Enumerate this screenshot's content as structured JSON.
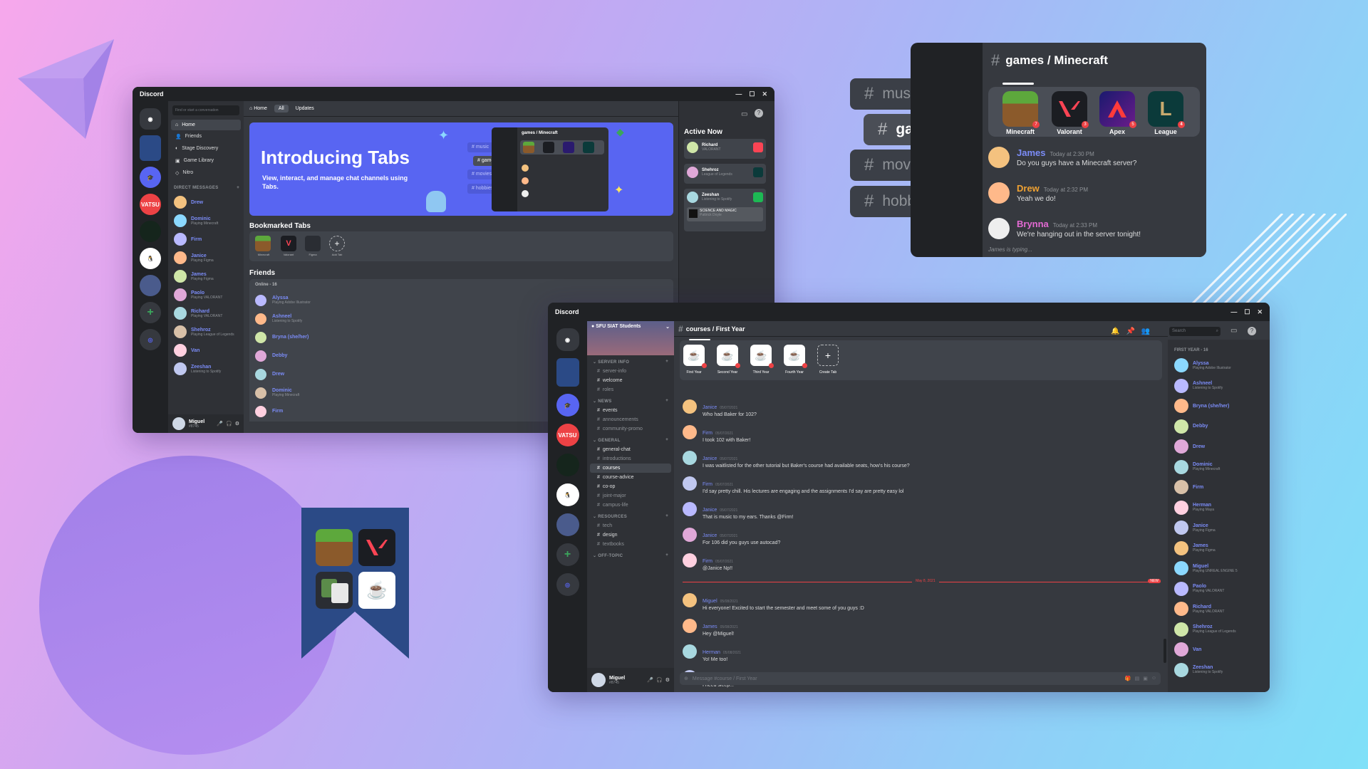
{
  "colors": {
    "blurple": "#5865f2",
    "dark": "#202225",
    "side": "#2f3136",
    "main": "#36393f",
    "red": "#ed4245",
    "green": "#3ba55c",
    "name_blue": "#7b8cf7"
  },
  "pills": [
    "music",
    "games",
    "movies",
    "hobbies"
  ],
  "win_a": {
    "title": "Discord",
    "search_placeholder": "Find or start a conversation",
    "nav": [
      "Home",
      "Friends",
      "Stage Discovery",
      "Game Library",
      "Nitro"
    ],
    "dm_header": "DIRECT MESSAGES",
    "dms": [
      {
        "name": "Drew",
        "status": ""
      },
      {
        "name": "Dominic",
        "status": "Playing Minecraft"
      },
      {
        "name": "Firm",
        "status": ""
      },
      {
        "name": "Janice",
        "status": "Playing Figma"
      },
      {
        "name": "James",
        "status": "Playing Figma"
      },
      {
        "name": "Paolo",
        "status": "Playing VALORANT"
      },
      {
        "name": "Richard",
        "status": "Playing VALORANT"
      },
      {
        "name": "Shehroz",
        "status": "Playing League of Legends"
      },
      {
        "name": "Van",
        "status": ""
      },
      {
        "name": "Zeeshan",
        "status": "Listening to Spotify"
      }
    ],
    "user": {
      "name": "Miguel",
      "tag": "#8745"
    },
    "topbar": {
      "home": "Home",
      "all": "All",
      "updates": "Updates"
    },
    "banner": {
      "title": "Introducing Tabs",
      "subtitle": "View, interact, and manage chat channels using Tabs.",
      "mini_title": "games / Minecraft",
      "mini_tabs": [
        "music",
        "games",
        "movies",
        "hobbies"
      ]
    },
    "bookmarked_title": "Bookmarked Tabs",
    "bookmarked_items": [
      "Minecraft",
      "Valorant",
      "Figma",
      "Add Tab"
    ],
    "friends_title": "Friends",
    "online_label": "Online - 16",
    "friends": [
      {
        "name": "Alyssa",
        "status": "Playing Adobe Illustrator"
      },
      {
        "name": "Ashneel",
        "status": "Listening to Spotify"
      },
      {
        "name": "Bryna (she/her)",
        "status": ""
      },
      {
        "name": "Debby",
        "status": ""
      },
      {
        "name": "Drew",
        "status": ""
      },
      {
        "name": "Dominic",
        "status": "Playing Minecraft"
      },
      {
        "name": "Firm",
        "status": ""
      }
    ],
    "active_now_title": "Active Now",
    "active": [
      {
        "name": "Richard",
        "status": "VALORANT"
      },
      {
        "name": "Shehroz",
        "status": "League of Legends"
      },
      {
        "name": "Zeeshan",
        "status": "Listening to Spotify",
        "extra": "SCIENCE AND MAGIC",
        "extra_sub": "Pattrick Doyle"
      }
    ]
  },
  "tabs_panel": {
    "title": "games / Minecraft",
    "icons": [
      {
        "label": "Minecraft",
        "badge": "7"
      },
      {
        "label": "Valorant",
        "badge": "3"
      },
      {
        "label": "Apex",
        "badge": "5"
      },
      {
        "label": "League",
        "badge": "4"
      }
    ],
    "messages": [
      {
        "name": "James",
        "time": "Today at 2:30 PM",
        "text": "Do you guys have a Minecraft server?",
        "color": "#7b8cf7"
      },
      {
        "name": "Drew",
        "time": "Today at 2:32 PM",
        "text": "Yeah we do!",
        "color": "#f0a232"
      },
      {
        "name": "Brynna",
        "time": "Today at 2:33 PM",
        "text": "We're hanging out in the server tonight!",
        "color": "#e36ad3"
      }
    ],
    "typing": "James is typing..."
  },
  "win_b": {
    "title": "Discord",
    "server_name": "SFU SIAT Students",
    "channel_title": "courses / First Year",
    "search_placeholder": "Search",
    "categories": [
      {
        "name": "SERVER INFO",
        "channels": [
          {
            "n": "server-info",
            "s": "dim"
          },
          {
            "n": "welcome",
            "s": "bright"
          },
          {
            "n": "roles",
            "s": "dim"
          }
        ]
      },
      {
        "name": "NEWS",
        "channels": [
          {
            "n": "events",
            "s": "bright"
          },
          {
            "n": "announcements",
            "s": "dim"
          },
          {
            "n": "community-promo",
            "s": "dim"
          }
        ]
      },
      {
        "name": "GENERAL",
        "channels": [
          {
            "n": "general-chat",
            "s": "bright"
          },
          {
            "n": "introductions",
            "s": "dim"
          },
          {
            "n": "courses",
            "s": "on"
          },
          {
            "n": "course-advice",
            "s": "bright"
          },
          {
            "n": "co-op",
            "s": "bright"
          },
          {
            "n": "joint-major",
            "s": "dim"
          },
          {
            "n": "campus-life",
            "s": "dim"
          }
        ]
      },
      {
        "name": "RESOURCES",
        "channels": [
          {
            "n": "tech",
            "s": "dim"
          },
          {
            "n": "design",
            "s": "bright"
          },
          {
            "n": "textbooks",
            "s": "dim"
          }
        ]
      },
      {
        "name": "OFF-TOPIC",
        "channels": []
      }
    ],
    "year_tabs": [
      "First Year",
      "Second Year",
      "Third Year",
      "Fourth Year",
      "Create Tab"
    ],
    "messages": [
      {
        "name": "Janice",
        "time": "05/07/2021",
        "text": "Who had Baker for 102?"
      },
      {
        "name": "Firm",
        "time": "05/07/2021",
        "text": "I took 102 with Baker!"
      },
      {
        "name": "Janice",
        "time": "05/07/2021",
        "text": "I was waitlisted for the other tutorial but Baker's course had available seats, how's his course?"
      },
      {
        "name": "Firm",
        "time": "05/07/2021",
        "text": "I'd say pretty chill. His lectures are engaging and the assignments I'd say are pretty easy lol"
      },
      {
        "name": "Janice",
        "time": "05/07/2021",
        "text": "That is music to my ears. Thanks @Firm!"
      },
      {
        "name": "Janice",
        "time": "05/07/2021",
        "text": "For 106 did you guys use autocad?"
      },
      {
        "name": "Firm",
        "time": "05/07/2021",
        "text": "@Janice Np!!"
      }
    ],
    "divider_date": "May 8, 2021",
    "divider_tag": "NEW",
    "messages2": [
      {
        "name": "Miguel",
        "time": "05/08/2021",
        "text": "Hi everyone! Excited to start the semester and meet some of you guys :D"
      },
      {
        "name": "James",
        "time": "05/08/2021",
        "text": "Hey @Miguel!"
      },
      {
        "name": "Herman",
        "time": "05/08/2021",
        "text": "Yo! Me too!"
      },
      {
        "name": "Shehroz",
        "time": "05/08/2021",
        "text": "I need sleep..."
      }
    ],
    "input_placeholder": "Message #course / First Year",
    "member_header": "FIRST YEAR - 16",
    "members": [
      {
        "name": "Alyssa",
        "status": "Playing Adobe Illustrator"
      },
      {
        "name": "Ashneel",
        "status": "Listening to Spotify"
      },
      {
        "name": "Bryna (she/her)",
        "status": ""
      },
      {
        "name": "Debby",
        "status": ""
      },
      {
        "name": "Drew",
        "status": ""
      },
      {
        "name": "Dominic",
        "status": "Playing Minecraft"
      },
      {
        "name": "Firm",
        "status": ""
      },
      {
        "name": "Herman",
        "status": "Playing Maya"
      },
      {
        "name": "Janice",
        "status": "Playing Figma"
      },
      {
        "name": "James",
        "status": "Playing Figma"
      },
      {
        "name": "Miguel",
        "status": "Playing UNREAL ENGINE 5"
      },
      {
        "name": "Paolo",
        "status": "Playing VALORANT"
      },
      {
        "name": "Richard",
        "status": "Playing VALORANT"
      },
      {
        "name": "Shehroz",
        "status": "Playing League of Legends"
      },
      {
        "name": "Van",
        "status": ""
      },
      {
        "name": "Zeeshan",
        "status": "Listening to Spotify"
      }
    ],
    "user": {
      "name": "Miguel",
      "tag": "#8745"
    }
  }
}
